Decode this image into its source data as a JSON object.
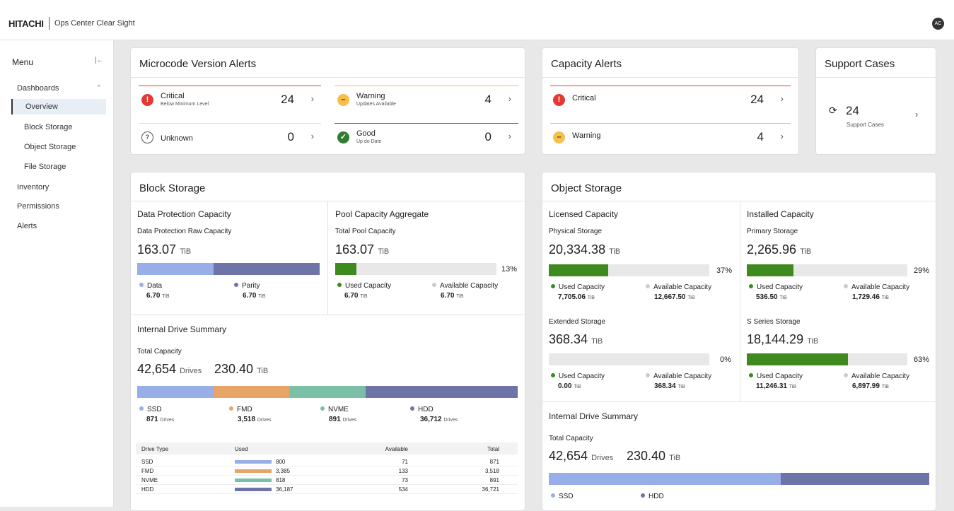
{
  "header": {
    "brand": "HITACHI",
    "product": "Ops Center Clear Sight",
    "avatar": "AC"
  },
  "sidebar": {
    "title": "Menu",
    "collapse_icon": "collapse-left-icon",
    "items": [
      {
        "label": "Dashboards",
        "expanded": true
      },
      {
        "label": "Overview",
        "active": true
      },
      {
        "label": "Block Storage"
      },
      {
        "label": "Object Storage"
      },
      {
        "label": "File Storage"
      },
      {
        "label": "Inventory"
      },
      {
        "label": "Permissions"
      },
      {
        "label": "Alerts"
      }
    ]
  },
  "colors": {
    "critical": "#e53935",
    "warning": "#f7c04a",
    "good": "#2e7d32",
    "data": "#97aee8",
    "parity": "#6f74a8",
    "used": "#3f8a1e",
    "fmd": "#e8a466",
    "nvme": "#79c0a6",
    "hdd": "#6f74a8"
  },
  "microcode": {
    "title": "Microcode Version Alerts",
    "critical": {
      "label": "Critical",
      "sub": "Below Minimum Level",
      "count": "24"
    },
    "warning": {
      "label": "Warning",
      "sub": "Updates Available",
      "count": "4"
    },
    "unknown": {
      "label": "Unknown",
      "count": "0"
    },
    "good": {
      "label": "Good",
      "sub": "Up do Date",
      "count": "0"
    }
  },
  "capacity_alerts": {
    "title": "Capacity Alerts",
    "critical": {
      "label": "Critical",
      "count": "24"
    },
    "warning": {
      "label": "Warning",
      "count": "4"
    }
  },
  "support": {
    "title": "Support Cases",
    "count": "24",
    "label": "Support Cases"
  },
  "block": {
    "title": "Block Storage",
    "dpc": {
      "title": "Data Protection Capacity",
      "sub": "Data Protection Raw Capacity",
      "value": "163.07",
      "unit": "TiB",
      "data_share": 0.42,
      "data": {
        "label": "Data",
        "value": "6.70",
        "unit": "TiB"
      },
      "parity": {
        "label": "Parity",
        "value": "6.70",
        "unit": "TiB"
      }
    },
    "pool": {
      "title": "Pool Capacity Aggregate",
      "sub": "Total Pool Capacity",
      "value": "163.07",
      "unit": "TiB",
      "percent": "13%",
      "fraction": 0.13,
      "used": {
        "label": "Used Capacity",
        "value": "6.70",
        "unit": "TiB"
      },
      "available": {
        "label": "Available Capacity",
        "value": "6.70",
        "unit": "TiB"
      }
    },
    "ids": {
      "title": "Internal Drive Summary",
      "sub": "Total Capacity",
      "drives": "42,654",
      "drives_unit": "Drives",
      "capacity": "230.40",
      "capacity_unit": "TiB",
      "shares": [
        0.2,
        0.2,
        0.2,
        0.4
      ],
      "legend": [
        {
          "label": "SSD",
          "value": "871",
          "unit": "Drives"
        },
        {
          "label": "FMD",
          "value": "3,518",
          "unit": "Drives"
        },
        {
          "label": "NVME",
          "value": "891",
          "unit": "Drives"
        },
        {
          "label": "HDD",
          "value": "36,712",
          "unit": "Drives"
        }
      ],
      "table": {
        "headers": [
          "Drive Type",
          "Used",
          "Available",
          "Total"
        ],
        "rows": [
          {
            "type": "SSD",
            "used": "800",
            "available": "71",
            "total": "871",
            "frac": 0.35
          },
          {
            "type": "FMD",
            "used": "3,385",
            "available": "133",
            "total": "3,518",
            "frac": 0.35
          },
          {
            "type": "NVME",
            "used": "818",
            "available": "73",
            "total": "891",
            "frac": 0.35
          },
          {
            "type": "HDD",
            "used": "36,187",
            "available": "534",
            "total": "36,721",
            "frac": 0.35
          }
        ]
      }
    }
  },
  "object": {
    "title": "Object Storage",
    "licensed": {
      "title": "Licensed Capacity",
      "physical": {
        "sub": "Physical Storage",
        "value": "20,334.38",
        "unit": "TiB",
        "percent": "37%",
        "fraction": 0.37,
        "used": {
          "label": "Used Capacity",
          "value": "7,705.06",
          "unit": "TiB"
        },
        "available": {
          "label": "Available Capacity",
          "value": "12,667.50",
          "unit": "TiB"
        }
      },
      "extended": {
        "sub": "Extended Storage",
        "value": "368.34",
        "unit": "TiB",
        "percent": "0%",
        "fraction": 0,
        "used": {
          "label": "Used Capacity",
          "value": "0.00",
          "unit": "TiB"
        },
        "available": {
          "label": "Available Capacity",
          "value": "368.34",
          "unit": "TiB"
        }
      }
    },
    "installed": {
      "title": "Installed Capacity",
      "primary": {
        "sub": "Primary Storage",
        "value": "2,265.96",
        "unit": "TiB",
        "percent": "29%",
        "fraction": 0.29,
        "used": {
          "label": "Used Capacity",
          "value": "536.50",
          "unit": "TiB"
        },
        "available": {
          "label": "Available Capacity",
          "value": "1,729.46",
          "unit": "TiB"
        }
      },
      "sseries": {
        "sub": "S Series Storage",
        "value": "18,144.29",
        "unit": "TiB",
        "percent": "63%",
        "fraction": 0.63,
        "used": {
          "label": "Used Capacity",
          "value": "11,246.31",
          "unit": "TiB"
        },
        "available": {
          "label": "Available Capacity",
          "value": "6,897.99",
          "unit": "TiB"
        }
      }
    },
    "ids": {
      "title": "Internal Drive Summary",
      "sub": "Total Capacity",
      "drives": "42,654",
      "drives_unit": "Drives",
      "capacity": "230.40",
      "capacity_unit": "TiB",
      "ssd_share": 0.61,
      "legend": [
        {
          "label": "SSD"
        },
        {
          "label": "HDD"
        }
      ]
    }
  }
}
